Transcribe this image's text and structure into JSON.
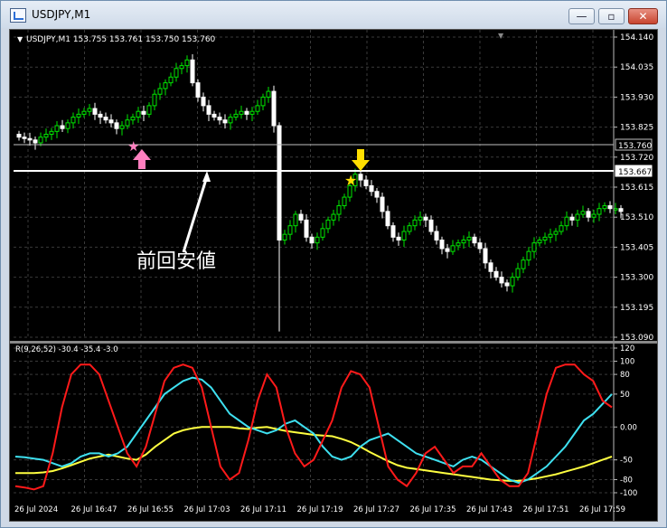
{
  "window": {
    "title": "USDJPY,M1",
    "minimize": "—",
    "restore": "▫",
    "close": "✕"
  },
  "chart": {
    "header": "USDJPY,M1  153.755 153.761 153.750 153.760",
    "price_ticks": [
      "154.140",
      "154.035",
      "153.930",
      "153.825",
      "153.720",
      "153.615",
      "153.510",
      "153.405",
      "153.300",
      "153.195",
      "153.090"
    ],
    "current_price": "153.760",
    "line_price": "153.667",
    "annotation_text": "前回安値",
    "time_ticks": [
      "26 Jul 2024",
      "26 Jul 16:47",
      "26 Jul 16:55",
      "26 Jul 17:03",
      "26 Jul 17:11",
      "26 Jul 17:19",
      "26 Jul 17:27",
      "26 Jul 17:35",
      "26 Jul 17:43",
      "26 Jul 17:51",
      "26 Jul 17:59"
    ]
  },
  "indicator": {
    "header": "R(9,26,52) -30.4 -35.4 -3.0",
    "ticks": [
      "120",
      "100",
      "80",
      "50",
      "0.00",
      "-50",
      "-80",
      "-100"
    ]
  },
  "colors": {
    "bull": "#00e600",
    "bear": "#ffffff",
    "grid": "#3a3a3a",
    "line_red": "#ff1a1a",
    "line_cyan": "#3ee0f0",
    "line_yellow": "#ffff40",
    "star_pink": "#ff7fbf",
    "star_yellow": "#ffdf00"
  },
  "icons": {
    "arrow_up": "pink-up-arrow-icon",
    "arrow_down": "yellow-down-arrow-icon",
    "star": "star-icon"
  }
}
